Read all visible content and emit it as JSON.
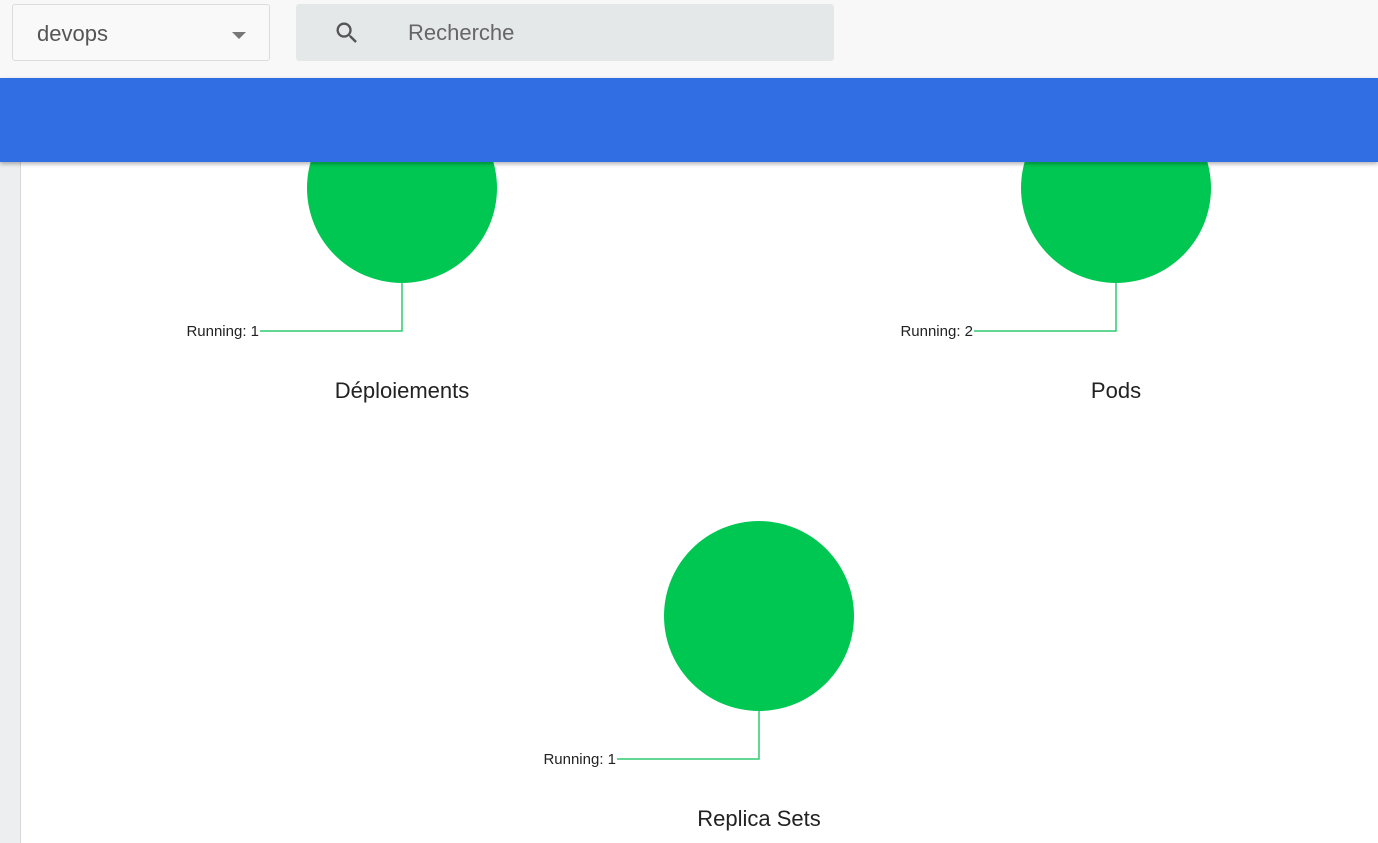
{
  "header": {
    "namespace": "devops",
    "search_placeholder": "Recherche"
  },
  "colors": {
    "accent": "#316ee4",
    "running": "#00c752"
  },
  "chart_data": [
    {
      "type": "pie",
      "title": "Déploiements",
      "slices": [
        {
          "label": "Running",
          "value": 1
        }
      ],
      "label_text": "Running: 1"
    },
    {
      "type": "pie",
      "title": "Pods",
      "slices": [
        {
          "label": "Running",
          "value": 2
        }
      ],
      "label_text": "Running: 2"
    },
    {
      "type": "pie",
      "title": "Replica Sets",
      "slices": [
        {
          "label": "Running",
          "value": 1
        }
      ],
      "label_text": "Running: 1"
    }
  ]
}
